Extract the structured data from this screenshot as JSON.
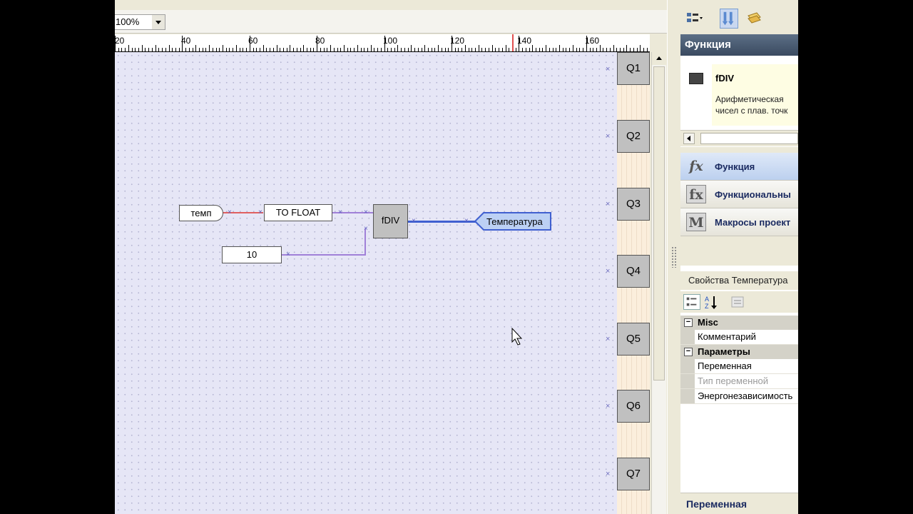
{
  "canvas": {
    "zoom": "100%",
    "ruler_labels": [
      "20",
      "40",
      "60",
      "80",
      "100",
      "120",
      "140",
      "160"
    ],
    "outputs": [
      "Q1",
      "Q2",
      "Q3",
      "Q4",
      "Q5",
      "Q6",
      "Q7"
    ],
    "blocks": {
      "input_var": "темп",
      "converter": "TO FLOAT",
      "constant": "10",
      "function": "fDIV",
      "output_var": "Температура"
    }
  },
  "right_panel": {
    "header": "Функция",
    "function_info": {
      "name": "fDIV",
      "desc_line1": "Арифметическая",
      "desc_line2": "чисел с плав. точк"
    },
    "categories": [
      {
        "icon": "fx",
        "label": "Функция"
      },
      {
        "icon": "fx",
        "label": "Функциональны"
      },
      {
        "icon": "M",
        "label": "Макросы проект"
      }
    ],
    "properties_title": "Свойства Температура",
    "grid": {
      "misc": "Misc",
      "comment": "Комментарий",
      "params": "Параметры",
      "variable": "Переменная",
      "var_type": "Тип переменной",
      "nonvolatile": "Энергонезависимость"
    },
    "footer": "Переменная"
  },
  "colors": {
    "canvas_bg": "#e6e6f6",
    "wire_red": "#e06060",
    "wire_purple": "#a080d8",
    "wire_blue": "#4060d0",
    "output_tag": "#bcd0f4"
  }
}
